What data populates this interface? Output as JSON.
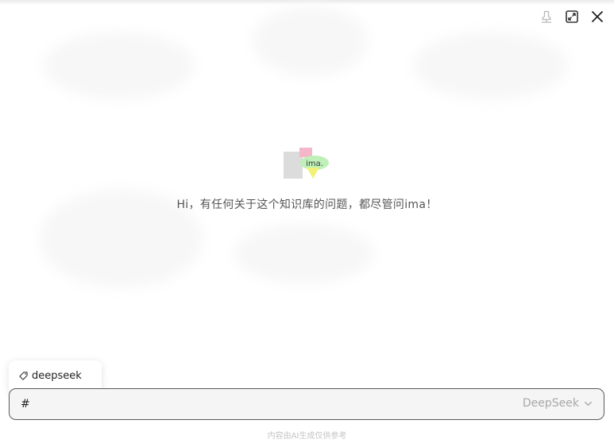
{
  "window_controls": {
    "pin_icon": "pin-icon",
    "maximize_icon": "maximize-icon",
    "close_icon": "close-icon"
  },
  "hero": {
    "logo_text": "ima.",
    "greeting": "Hi，有任何关于这个知识库的问题，都尽管问ima！"
  },
  "tag_popup": {
    "items": [
      {
        "icon": "tag-icon",
        "label": "deepseek"
      }
    ]
  },
  "composer": {
    "input_value": "#",
    "placeholder": "",
    "model_selected": "DeepSeek",
    "model_dropdown_icon": "chevron-down-icon"
  },
  "footer": {
    "disclaimer": "内容由AI生成仅供参考"
  },
  "colors": {
    "input_border": "#5a5a5a",
    "input_background": "#f5f5f5",
    "muted_text": "#a8a8a8",
    "logo_green": "#7ed67a",
    "logo_pink": "#f4b6c8",
    "logo_yellow": "#f2f27a"
  }
}
